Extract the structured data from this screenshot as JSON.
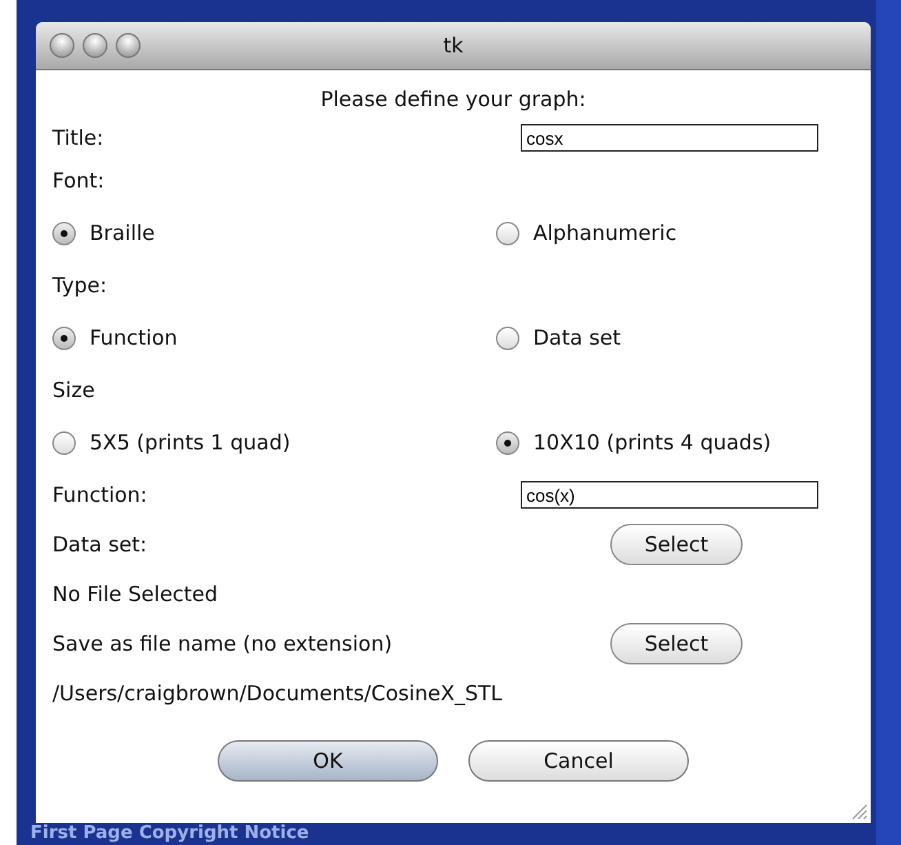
{
  "window": {
    "title": "tk"
  },
  "heading": "Please define your graph:",
  "title_field": {
    "label": "Title:",
    "value": "cosx"
  },
  "groups": [
    {
      "label": "Font:",
      "options": [
        {
          "label": "Braille",
          "selected": true
        },
        {
          "label": "Alphanumeric",
          "selected": false
        }
      ]
    },
    {
      "label": "Type:",
      "options": [
        {
          "label": "Function",
          "selected": true
        },
        {
          "label": "Data set",
          "selected": false
        }
      ]
    },
    {
      "label": "Size",
      "options": [
        {
          "label": "5X5 (prints 1 quad)",
          "selected": false
        },
        {
          "label": "10X10 (prints 4 quads)",
          "selected": true
        }
      ]
    }
  ],
  "function_field": {
    "label": "Function:",
    "value": "cos(x)"
  },
  "data_set": {
    "label": "Data set:",
    "button": "Select",
    "status": "No File Selected"
  },
  "save": {
    "label": "Save as file name (no extension)",
    "button": "Select",
    "path": "/Users/craigbrown/Documents/CosineX_STL"
  },
  "buttons": [
    {
      "label": "OK",
      "default": true
    },
    {
      "label": "Cancel",
      "default": false
    }
  ],
  "background": {
    "footer_text": "First Page Copyright Notice"
  }
}
